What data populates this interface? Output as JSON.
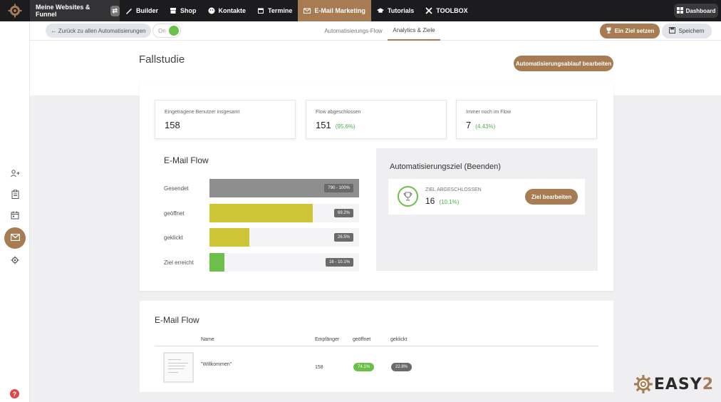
{
  "topnav": {
    "websites_label": "Meine Websites & Funnel",
    "items": [
      {
        "label": "Builder",
        "icon": "brush-icon"
      },
      {
        "label": "Shop",
        "icon": "store-icon"
      },
      {
        "label": "Kontakte",
        "icon": "contacts-icon"
      },
      {
        "label": "Termine",
        "icon": "calendar-icon"
      },
      {
        "label": "E-Mail Marketing",
        "icon": "mail-icon",
        "active": true
      },
      {
        "label": "Tutorials",
        "icon": "graduation-cap-icon"
      },
      {
        "label": "TOOLBOX",
        "icon": "tools-icon"
      }
    ],
    "dashboard_label": "Dashboard"
  },
  "subheader": {
    "back_label": "← Zurück zu allen Automatisierungen",
    "toggle_label": "On",
    "tabs": [
      {
        "label": "Automatisierungs-Flow"
      },
      {
        "label": "Analytics & Ziele",
        "active": true
      }
    ],
    "goal_label": "Ein Ziel setzen",
    "save_label": "Speichern"
  },
  "page": {
    "title": "Fallstudie",
    "edit_flow_label": "Automatisierungsablauf bearbeiten"
  },
  "stats": [
    {
      "label": "Eingetragene Benutzer insgesamt",
      "value": "158",
      "pct": ""
    },
    {
      "label": "Flow abgeschlossen",
      "value": "151",
      "pct": "(95.6%)"
    },
    {
      "label": "Immer noch im Flow",
      "value": "7",
      "pct": "(4.43%)"
    }
  ],
  "email_flow": {
    "title": "E-Mail Flow",
    "rows": [
      {
        "label": "Gesendet",
        "badge": "790 - 100%",
        "fraction": 1.0,
        "color": "#8e8e8e"
      },
      {
        "label": "geöffnet",
        "badge": "69.2%",
        "fraction": 0.692,
        "color": "#cdc535"
      },
      {
        "label": "geklickt",
        "badge": "26.5%",
        "fraction": 0.265,
        "color": "#cdc535"
      },
      {
        "label": "Ziel erreicht",
        "badge": "16 - 10.1%",
        "fraction": 0.101,
        "color": "#6cc04a"
      }
    ]
  },
  "goal": {
    "title": "Automatisierungsziel (Beenden)",
    "label": "ZIEL ABGESCHLOSSEN",
    "value": "16",
    "pct": "(10.1%)",
    "edit_label": "Ziel bearbeiten"
  },
  "table": {
    "title": "E-Mail Flow",
    "headers": {
      "name": "Name",
      "recipients": "Empfänger",
      "opened": "geöffnet",
      "clicked": "geklickt"
    },
    "rows": [
      {
        "name": "\"Willkommen\"",
        "recipients": "158",
        "opened": "74.1%",
        "clicked": "22.8%"
      }
    ]
  },
  "colors": {
    "accent": "#a77c53",
    "success": "#6cc04a",
    "nav_bg": "#1c1c1f"
  },
  "brand": {
    "prefix": "EASY",
    "suffix": "2"
  }
}
